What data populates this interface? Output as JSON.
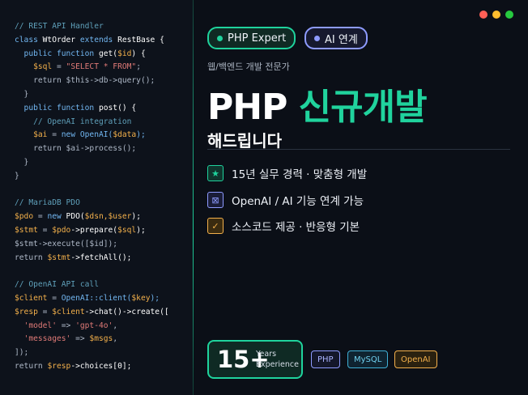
{
  "code": {
    "lines": [
      [
        [
          "// REST API Handler",
          "c-com"
        ]
      ],
      [
        [
          "class ",
          "c-kw"
        ],
        [
          "WtOrder ",
          "c-fn"
        ],
        [
          "extends ",
          "c-kw"
        ],
        [
          "RestBase {",
          "c-fn"
        ]
      ],
      [
        [
          "  public function ",
          "c-kw"
        ],
        [
          "get(",
          "c-fn"
        ],
        [
          "$id",
          "c-var"
        ],
        [
          ") {",
          "c-fn"
        ]
      ],
      [
        [
          "    $sql",
          "c-var"
        ],
        [
          " = ",
          "c-dim"
        ],
        [
          "\"SELECT * FROM\"",
          "c-str"
        ],
        [
          ";",
          "c-dim"
        ]
      ],
      [
        [
          "    return $this->db->query();",
          "c-dim"
        ]
      ],
      [
        [
          "  }",
          "c-dim"
        ]
      ],
      [
        [
          "  public function ",
          "c-kw"
        ],
        [
          "post() {",
          "c-fn"
        ]
      ],
      [
        [
          "    // OpenAI integration",
          "c-com"
        ]
      ],
      [
        [
          "    $ai",
          "c-var"
        ],
        [
          " = ",
          "c-dim"
        ],
        [
          "new ",
          "c-kw"
        ],
        [
          "OpenAI(",
          "c-kw"
        ],
        [
          "$data",
          "c-var"
        ],
        [
          ");",
          "c-kw"
        ]
      ],
      [
        [
          "    return $ai->process();",
          "c-dim"
        ]
      ],
      [
        [
          "  }",
          "c-dim"
        ]
      ],
      [
        [
          "}",
          "c-dim"
        ]
      ],
      [],
      [
        [
          "// MariaDB PDO",
          "c-com"
        ]
      ],
      [
        [
          "$pdo",
          "c-var"
        ],
        [
          " = ",
          "c-dim"
        ],
        [
          "new ",
          "c-kw"
        ],
        [
          "PDO(",
          "c-fn"
        ],
        [
          "$dsn,$user",
          "c-var"
        ],
        [
          ");",
          "c-fn"
        ]
      ],
      [
        [
          "$stmt",
          "c-var"
        ],
        [
          " = ",
          "c-dim"
        ],
        [
          "$pdo",
          "c-var"
        ],
        [
          "->prepare(",
          "c-fn"
        ],
        [
          "$sql",
          "c-var"
        ],
        [
          ");",
          "c-fn"
        ]
      ],
      [
        [
          "$stmt->execute([$id]);",
          "c-dim"
        ]
      ],
      [
        [
          "return ",
          "c-dim"
        ],
        [
          "$stmt",
          "c-var"
        ],
        [
          "->fetchAll();",
          "c-fn"
        ]
      ],
      [],
      [
        [
          "// OpenAI API call",
          "c-com"
        ]
      ],
      [
        [
          "$client",
          "c-var"
        ],
        [
          " = ",
          "c-dim"
        ],
        [
          "OpenAI::client(",
          "c-kw"
        ],
        [
          "$key",
          "c-var"
        ],
        [
          ");",
          "c-kw"
        ]
      ],
      [
        [
          "$resp",
          "c-var"
        ],
        [
          " = ",
          "c-dim"
        ],
        [
          "$client",
          "c-var"
        ],
        [
          "->chat()->create([",
          "c-fn"
        ]
      ],
      [
        [
          "  'model' ",
          "c-str"
        ],
        [
          "=> ",
          "c-dim"
        ],
        [
          "'gpt-4o'",
          "c-str"
        ],
        [
          ",",
          "c-dim"
        ]
      ],
      [
        [
          "  'messages' ",
          "c-str"
        ],
        [
          "=> ",
          "c-dim"
        ],
        [
          "$msgs",
          "c-var"
        ],
        [
          ",",
          "c-dim"
        ]
      ],
      [
        [
          "]);",
          "c-dim"
        ]
      ],
      [
        [
          "return ",
          "c-dim"
        ],
        [
          "$resp",
          "c-var"
        ],
        [
          "->choices[0];",
          "c-fn"
        ]
      ]
    ]
  },
  "badges": {
    "php": "PHP Expert",
    "ai": "AI 연계"
  },
  "subtitle": "웹/백엔드 개발 전문가",
  "headline": {
    "part1": "PHP ",
    "part2": "신규개발"
  },
  "subheadline": "해드립니다",
  "features": [
    {
      "icon": "star-icon",
      "glyph": "★",
      "text": "15년 실무 경력 · 맞춤형 개발"
    },
    {
      "icon": "ai-box-icon",
      "glyph": "⊠",
      "text": "OpenAI / AI 기능 연계 가능"
    },
    {
      "icon": "check-icon",
      "glyph": "✓",
      "text": "소스코드 제공 · 반응형 기본"
    }
  ],
  "experience": {
    "number": "15+",
    "line1": "Years",
    "line2": "Experience"
  },
  "tags": [
    "PHP",
    "MySQL",
    "OpenAI"
  ],
  "colors": {
    "accent": "#1fd39d",
    "purple": "#8e9bff",
    "amber": "#f3b04b",
    "blue": "#3fb0d6",
    "background": "#0b0f17"
  }
}
